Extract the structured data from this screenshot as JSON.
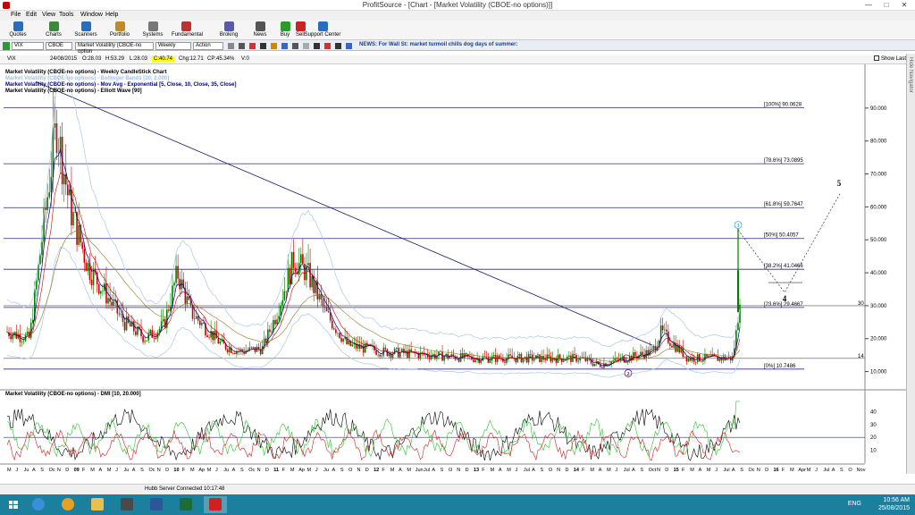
{
  "window": {
    "title": "ProfitSource - [Chart - [Market Volatility (CBOE-no options)]]",
    "min": "—",
    "max": "□",
    "close": "✕"
  },
  "menu": [
    "File",
    "Edit",
    "View",
    "Tools",
    "Window",
    "Help"
  ],
  "toolbar": [
    {
      "label": "Quotes",
      "icon": "quotes-icon",
      "color": "#2a6ebb"
    },
    {
      "label": "Charts",
      "icon": "charts-icon",
      "color": "#3b8a3b"
    },
    {
      "label": "Scanners",
      "icon": "scanners-icon",
      "color": "#2a6ebb"
    },
    {
      "label": "Portfolio",
      "icon": "portfolio-icon",
      "color": "#c08a2a"
    },
    {
      "label": "Systems",
      "icon": "systems-icon",
      "color": "#777777"
    },
    {
      "label": "Fundamental",
      "icon": "fundamental-icon",
      "color": "#bb3333"
    },
    {
      "label": "Broking",
      "icon": "broking-icon",
      "color": "#5a5aaa"
    },
    {
      "label": "News",
      "icon": "news-icon",
      "color": "#555555"
    },
    {
      "label": "Buy",
      "icon": "buy-icon",
      "color": "#2e9a2e"
    },
    {
      "label": "Sell",
      "icon": "sell-icon",
      "color": "#cc2222"
    },
    {
      "label": "Support Center",
      "icon": "help-icon",
      "color": "#2a6ebb"
    }
  ],
  "symbar": {
    "symbol": "VIX",
    "exchange": "CBOE",
    "name": "Market Volatility (CBOE-no option",
    "period": "Weekly",
    "action": "Action",
    "news": "NEWS: For Wall St: market turmoil chills dog days of summer:"
  },
  "infobar": {
    "symbol": "VIX",
    "date": "24/08/2015",
    "open": "O:28.03",
    "high": "H:53.29",
    "low": "L:28.03",
    "close": "C:40.74",
    "chg": "Chg:12.71",
    "cp": "CP:45.34%",
    "vol": "V:0",
    "show_last": "Show Last"
  },
  "right_panel": "Hide Navigator",
  "legend": [
    {
      "text": "Market Volatility (CBOE-no options) - Weekly CandleStick Chart",
      "color": "#000000"
    },
    {
      "text": "Market Volatility (CBOE-no options) - Bollinger Bands [20, 2.000]",
      "color": "#9fbfdf"
    },
    {
      "text": "Market Volatility (CBOE-no options) - Mov Avg - Exponential [5, Close, 10, Close, 35, Close]",
      "color": "#000080"
    },
    {
      "text": "Market Volatility (CBOE-no options) - Elliott Wave [90]",
      "color": "#000000"
    }
  ],
  "chart_data": {
    "type": "candlestick",
    "y_ticks": [
      "90.000",
      "80.000",
      "70.000",
      "60.000",
      "50.000",
      "40.000",
      "30.000",
      "20.000",
      "10.000"
    ],
    "fib_levels": [
      {
        "label": "[100%] 90.0628",
        "value": 90.0628
      },
      {
        "label": "[78.6%] 73.0895",
        "value": 73.0895
      },
      {
        "label": "[61.8%] 59.7647",
        "value": 59.7647
      },
      {
        "label": "[50%] 50.4057",
        "value": 50.4057
      },
      {
        "label": "[38.2%] 41.0466",
        "value": 41.0466
      },
      {
        "label": "[23.6%] 29.4667",
        "value": 29.4667
      },
      {
        "label": "[0%] 10.7486",
        "value": 10.7486
      }
    ],
    "markers": [
      {
        "label": "30",
        "value": 30
      },
      {
        "label": "14",
        "value": 14
      }
    ],
    "elliott_labels": [
      "1",
      "2",
      "3",
      "4",
      "5"
    ],
    "dmi": {
      "title": "Market Volatility (CBOE-no options) - DMI [10, 20.000]",
      "ticks": [
        "40",
        "30",
        "20",
        "10"
      ],
      "ylim": [
        0,
        50
      ]
    },
    "x_ticks": [
      "M",
      "J",
      "Ju",
      "A",
      "S",
      "Oc",
      "N",
      "D",
      "09",
      "F",
      "M",
      "A",
      "M",
      "J",
      "Ju",
      "A",
      "S",
      "Oc",
      "N",
      "D",
      "10",
      "F",
      "M",
      "Ap",
      "M",
      "J",
      "Ju",
      "A",
      "S",
      "Oc",
      "N",
      "D",
      "11",
      "F",
      "M",
      "Ap",
      "M",
      "J",
      "Ju",
      "A",
      "S",
      "O",
      "N",
      "D",
      "12",
      "F",
      "M",
      "A",
      "M",
      "Jun",
      "Jul",
      "A",
      "S",
      "O",
      "N",
      "D",
      "13",
      "F",
      "M",
      "A",
      "M",
      "J",
      "Jul",
      "A",
      "S",
      "O",
      "N",
      "D",
      "14",
      "F",
      "M",
      "A",
      "M",
      "J",
      "Jul",
      "A",
      "S",
      "Oct",
      "N",
      "D",
      "15",
      "F",
      "M",
      "A",
      "M",
      "J",
      "Jul",
      "A",
      "S",
      "Oc",
      "N",
      "D",
      "16",
      "F",
      "M",
      "Apr",
      "M",
      "J",
      "Jul",
      "A",
      "S",
      "O",
      "Nov"
    ],
    "ylim": [
      5,
      100
    ]
  },
  "status": {
    "server": "Hubb Server Connected 10:17:48"
  },
  "taskbar": {
    "apps": [
      {
        "name": "ie-icon",
        "color": "#3a8fd8"
      },
      {
        "name": "chrome-icon",
        "color": "#e8a020"
      },
      {
        "name": "explorer-icon",
        "color": "#e8c050"
      },
      {
        "name": "calculator-icon",
        "color": "#4a4a4a"
      },
      {
        "name": "word-icon",
        "color": "#2b579a"
      },
      {
        "name": "terminal-icon",
        "color": "#1e6b3a"
      },
      {
        "name": "profitsource-icon",
        "color": "#cc2222"
      }
    ],
    "lang": "ENG",
    "time": "10:56 AM",
    "date": "25/08/2015"
  }
}
